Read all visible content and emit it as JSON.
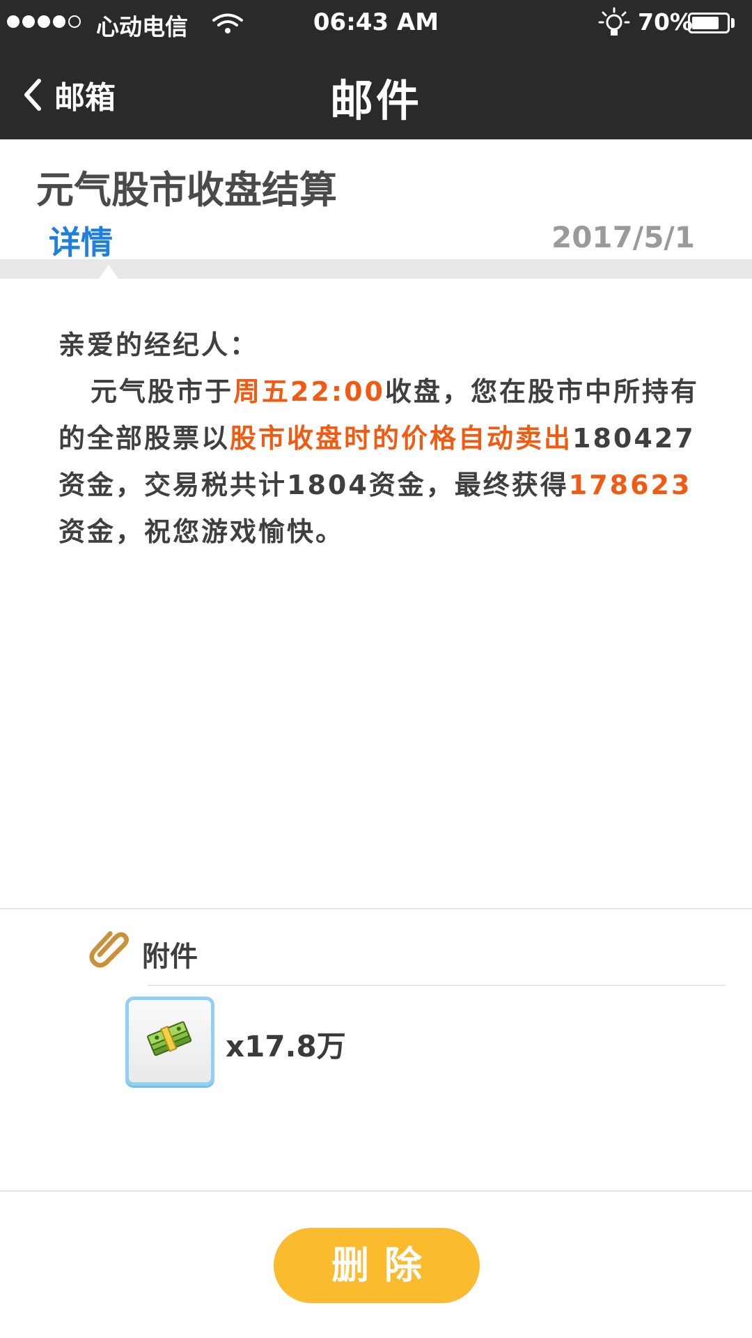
{
  "status_bar": {
    "carrier": "心动电信",
    "time": "06:43 AM",
    "battery": "70%",
    "battery_level": 0.7,
    "signal_bars": 4,
    "signal_total": 5
  },
  "nav": {
    "back_label": "邮箱",
    "title": "邮件"
  },
  "mail": {
    "title": "元气股市收盘结算",
    "tab": "详情",
    "date": "2017/5/1",
    "greeting": "亲爱的经纪人：",
    "segments": [
      {
        "text": "元气股市于",
        "highlight": false
      },
      {
        "text": "周五22:00",
        "highlight": true
      },
      {
        "text": "收盘，您在股市中所持有的全部股票以",
        "highlight": false
      },
      {
        "text": "股市收盘时的价格自动卖出",
        "highlight": true
      },
      {
        "text": "180427资金，交易税共计1804资金，最终获得",
        "highlight": false
      },
      {
        "text": "178623",
        "highlight": true
      },
      {
        "text": "资金，祝您游戏愉快。",
        "highlight": false
      }
    ]
  },
  "attachment": {
    "label": "附件",
    "item_icon": "money-stack-icon",
    "item_qty": "x17.8万"
  },
  "actions": {
    "delete_label": "删除"
  },
  "colors": {
    "nav_bg": "#2a2a2c",
    "tab_blue": "#1f7fe0",
    "highlight": "#f25a12",
    "delete_btn": "#fbbb2f",
    "clip": "#c9913a"
  }
}
